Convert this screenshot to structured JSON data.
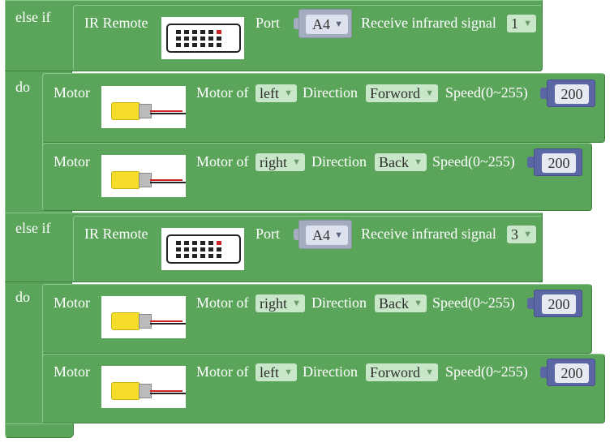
{
  "blocks": {
    "elseif1": {
      "label": "else if",
      "ir_label": "IR Remote",
      "port_label": "Port",
      "port_value": "A4",
      "signal_label": "Receive infrared signal",
      "signal_value": "1"
    },
    "do1": {
      "label": "do"
    },
    "m1": {
      "label": "Motor",
      "motor_of": "Motor of",
      "side": "left",
      "dir_label": "Direction",
      "dir": "Forword",
      "speed_label": "Speed(0~255)",
      "speed": "200"
    },
    "m2": {
      "label": "Motor",
      "motor_of": "Motor of",
      "side": "right",
      "dir_label": "Direction",
      "dir": "Back",
      "speed_label": "Speed(0~255)",
      "speed": "200"
    },
    "elseif2": {
      "label": "else if",
      "ir_label": "IR Remote",
      "port_label": "Port",
      "port_value": "A4",
      "signal_label": "Receive infrared signal",
      "signal_value": "3"
    },
    "do2": {
      "label": "do"
    },
    "m3": {
      "label": "Motor",
      "motor_of": "Motor of",
      "side": "right",
      "dir_label": "Direction",
      "dir": "Back",
      "speed_label": "Speed(0~255)",
      "speed": "200"
    },
    "m4": {
      "label": "Motor",
      "motor_of": "Motor of",
      "side": "left",
      "dir_label": "Direction",
      "dir": "Forword",
      "speed_label": "Speed(0~255)",
      "speed": "200"
    }
  },
  "icons": {
    "dropdown": "triangle-down-icon",
    "remote": "ir-remote-icon",
    "motor": "dc-motor-icon"
  },
  "colors": {
    "block": "#5ba55b",
    "value_block": "#5b67a5",
    "port_block": "#a4acc0"
  }
}
